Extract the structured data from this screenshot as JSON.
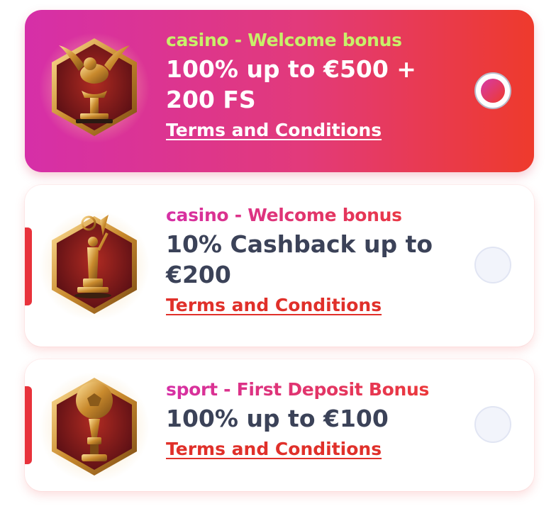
{
  "bonuses": [
    {
      "category": "casino",
      "separator": " - ",
      "type": "Welcome bonus",
      "title": "100% up to €500 + 200 FS",
      "terms": "Terms and Conditions",
      "selected": true,
      "icon": "winged-lion-trophy-icon"
    },
    {
      "category": "casino",
      "separator": " - ",
      "type": "Welcome bonus",
      "title": "10% Cashback up to €200",
      "terms": "Terms and Conditions",
      "selected": false,
      "icon": "statuette-trophy-icon"
    },
    {
      "category": "sport",
      "separator": " - ",
      "type": "First Deposit Bonus",
      "title": "100% up to €100",
      "terms": "Terms and Conditions",
      "selected": false,
      "icon": "football-trophy-icon"
    }
  ],
  "colors": {
    "selected_gradient_start": "#d62fa8",
    "selected_gradient_end": "#ee3a2c",
    "category_selected": "#c8f06a",
    "title_dark": "#3b4258",
    "terms_red": "#e0302a",
    "accent_red": "#e8323b"
  }
}
